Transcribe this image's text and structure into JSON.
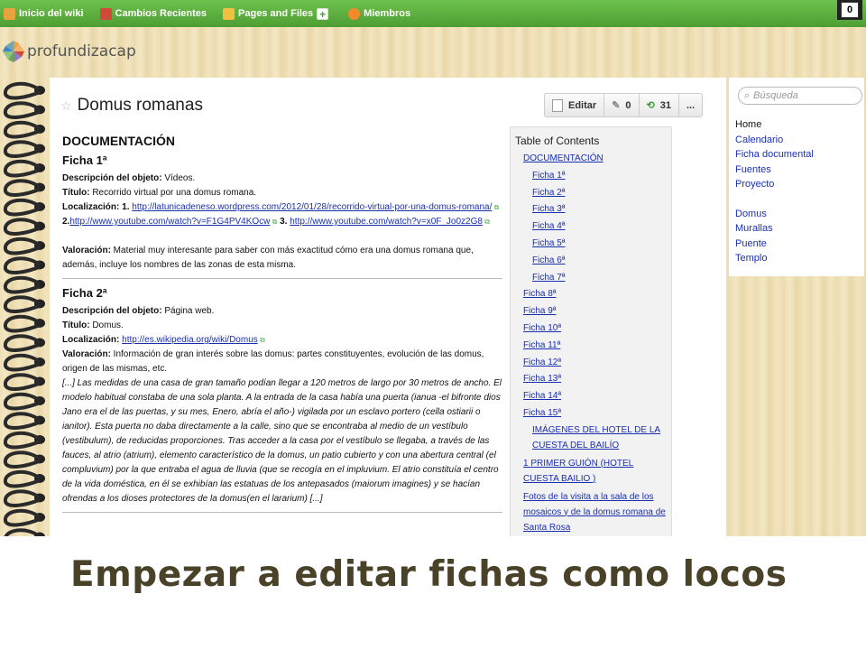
{
  "topnav": [
    {
      "label": "Inicio del wiki",
      "icon": "home-icon",
      "color": "#e8a33c"
    },
    {
      "label": "Cambios Recientes",
      "icon": "calendar-icon",
      "color": "#d04a3a"
    },
    {
      "label": "Pages and Files",
      "icon": "pages-icon",
      "color": "#f0c040"
    },
    {
      "label": "Miembros",
      "icon": "members-icon",
      "color": "#f08a2a"
    }
  ],
  "add_icon": "+",
  "notification_count": "0",
  "logo_text": "profundizacap",
  "page": {
    "title": "Domus romanas",
    "edit_label": "Editar",
    "comments_count": "0",
    "revisions_count": "31",
    "more_label": "..."
  },
  "content": {
    "heading": "DOCUMENTACIÓN",
    "ficha1": {
      "title": "Ficha 1ª",
      "desc_label": "Descripción del objeto:",
      "desc_value": " Vídeos.",
      "titulo_label": "Título:",
      "titulo_value": " Recorrido virtual por una domus romana.",
      "loc_label": "Localización:",
      "loc_1": " 1. ",
      "link1": "http://latunicadeneso.wordpress.com/2012/01/28/recorrido-virtual-por-una-domus-romana/",
      "loc_2": "2.",
      "link2": "http://www.youtube.com/watch?v=F1G4PV4KOcw",
      "loc_3": " 3. ",
      "link3": "http://www.youtube.com/watch?v=x0F_Jo0z2G8",
      "val_label": "Valoración:",
      "val_value": " Material muy interesante para saber con más exactitud cómo era una domus romana que, además, incluye los nombres de las zonas de esta misma."
    },
    "ficha2": {
      "title": "Ficha 2ª",
      "desc_label": "Descripción del objeto:",
      "desc_value": " Página web.",
      "titulo_label": "Título:",
      "titulo_value": " Domus.",
      "loc_label": "Localización:",
      "link1": "http://es.wikipedia.org/wiki/Domus",
      "val_label": "Valoración:",
      "val_value": " Información de gran interés sobre las domus: partes constituyentes, evolución de las domus, origen de las mismas, etc.",
      "quote": "[...] Las medidas de una casa de gran tamaño podían llegar a 120 metros de largo por 30 metros de ancho. El modelo habitual constaba de una sola planta. A la entrada de la casa había una puerta (ianua -el bifronte dios Jano era el de las puertas, y su mes, Enero, abría el año-) vigilada por un esclavo portero (cella ostiarii o ianitor). Esta puerta no daba directamente a la calle, sino que se encontraba al medio de un vestíbulo (vestibulum), de reducidas proporciones. Tras acceder a la casa por el vestíbulo se llegaba, a través de las fauces, al atrio (atrium), elemento característico de la domus, un patio cubierto y con una abertura central (el compluvium) por la que entraba el agua de lluvia (que se recogía en el impluvium. El atrio constituía el centro de la vida doméstica, en él se exhibían las estatuas de los antepasados (maiorum imagines) y se hacían ofrendas a los dioses protectores de la domus(en el lararium) [...]"
    }
  },
  "toc": {
    "title": "Table of Contents",
    "items": [
      {
        "label": "DOCUMENTACIÓN",
        "level": 1
      },
      {
        "label": "Ficha 1ª",
        "level": 2
      },
      {
        "label": "Ficha 2ª",
        "level": 2
      },
      {
        "label": "Ficha 3ª",
        "level": 2
      },
      {
        "label": "Ficha 4ª",
        "level": 2
      },
      {
        "label": "Ficha 5ª",
        "level": 2
      },
      {
        "label": "Ficha 6ª",
        "level": 2
      },
      {
        "label": "Ficha 7ª",
        "level": 2
      },
      {
        "label": "Ficha 8ª",
        "level": 0
      },
      {
        "label": "Ficha 9ª",
        "level": 0
      },
      {
        "label": "Ficha 10ª",
        "level": 0
      },
      {
        "label": "Ficha 11ª",
        "level": 0
      },
      {
        "label": "Ficha 12ª",
        "level": 0
      },
      {
        "label": "Ficha 13ª",
        "level": 0
      },
      {
        "label": "Ficha 14ª",
        "level": 0
      },
      {
        "label": "Ficha 15ª",
        "level": 0
      },
      {
        "label": "IMÁGENES DEL HOTEL DE LA CUESTA DEL BAILÍO",
        "level": 1
      },
      {
        "label": "1 PRIMER GUIÓN (HOTEL CUESTA BAILIO )",
        "level": 0
      },
      {
        "label": "Fotos de la visita a la sala de los mosaicos y de la domus romana de Santa Rosa",
        "level": 0
      }
    ]
  },
  "sidebar": {
    "search_placeholder": "Búsqueda",
    "links_group1": [
      "Home",
      "Calendario",
      "Ficha documental",
      "Fuentes",
      "Proyecto"
    ],
    "links_group2": [
      "Domus",
      "Murallas",
      "Puente",
      "Templo"
    ]
  },
  "headline": "Empezar a editar fichas como locos",
  "colors": {
    "link": "#1a2fb0",
    "topbar": "#5aae3c",
    "headline": "#4a4228"
  }
}
